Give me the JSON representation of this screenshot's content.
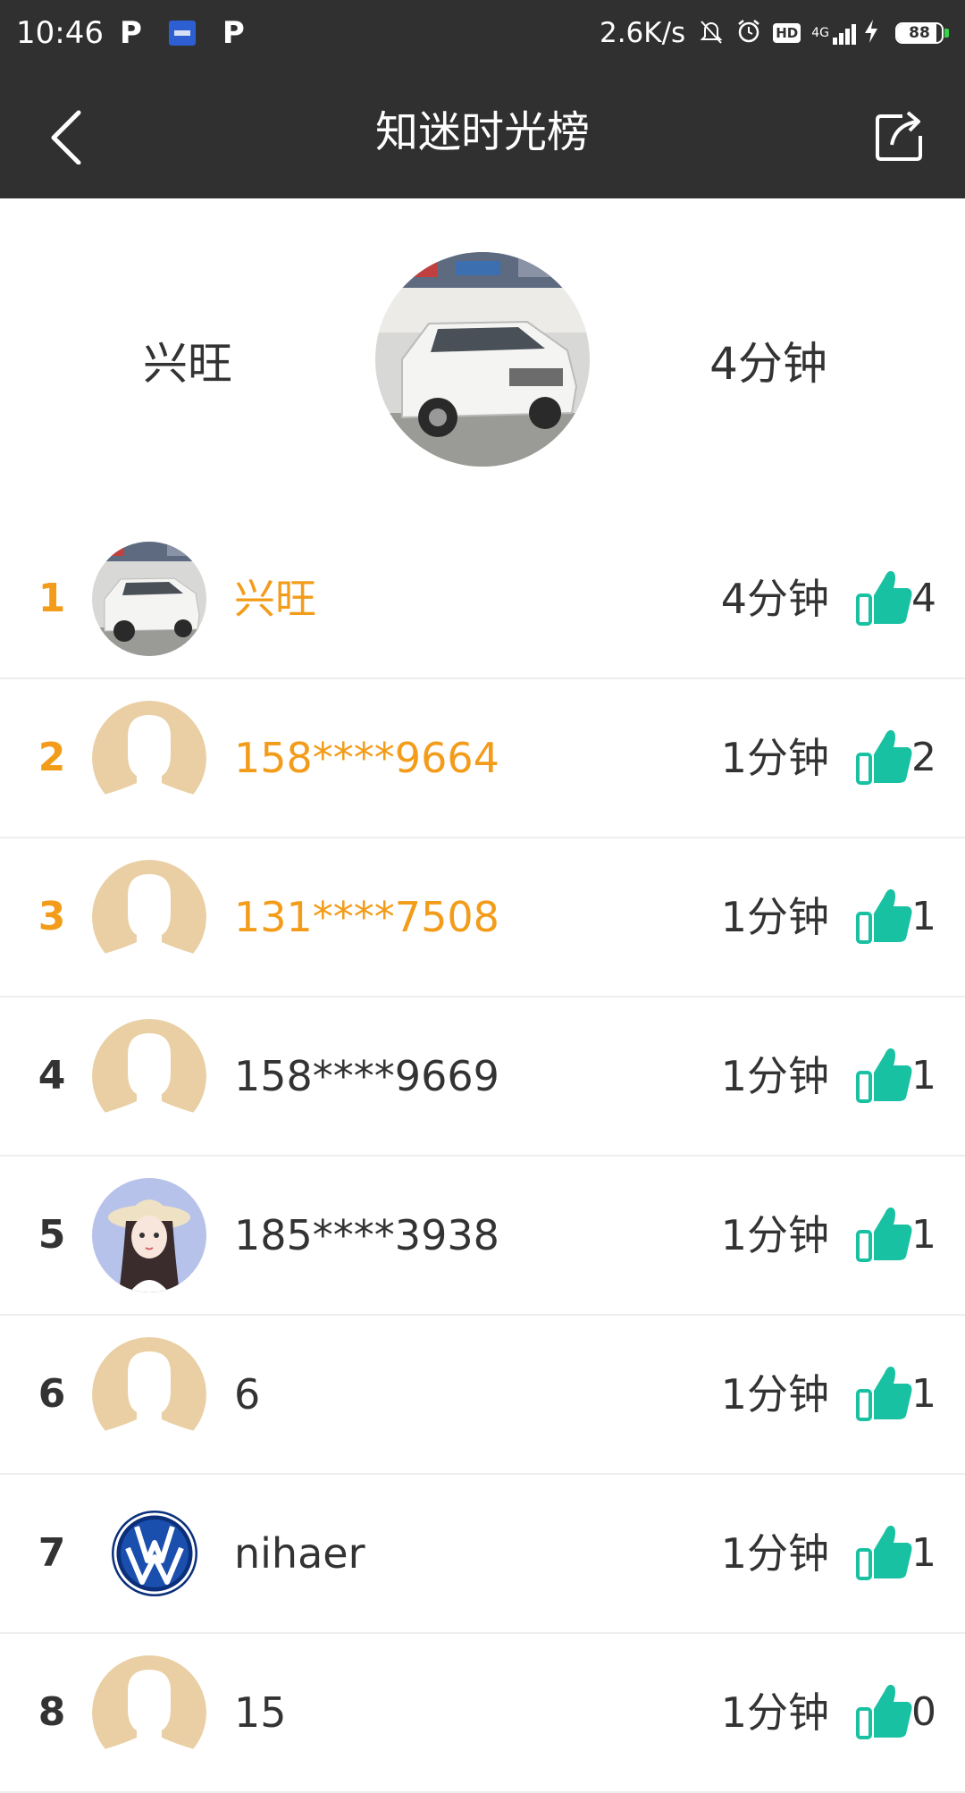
{
  "status_bar": {
    "time": "10:46",
    "app_icon_p": "P",
    "speed": "2.6K/s",
    "hd": "HD",
    "network": "4G",
    "battery_level": "88",
    "battery_fraction": 0.88
  },
  "header": {
    "title": "知迷时光榜",
    "back_icon": "chevron-left-icon",
    "share_icon": "share-icon"
  },
  "top_user": {
    "name": "兴旺",
    "time": "4分钟",
    "avatar": "car-photo"
  },
  "leaderboard": [
    {
      "rank": "1",
      "name": "兴旺",
      "time": "4分钟",
      "likes": "4",
      "avatar": "car-photo",
      "highlight": true
    },
    {
      "rank": "2",
      "name": "158****9664",
      "time": "1分钟",
      "likes": "2",
      "avatar": "default-avatar",
      "highlight": true
    },
    {
      "rank": "3",
      "name": "131****7508",
      "time": "1分钟",
      "likes": "1",
      "avatar": "default-avatar",
      "highlight": true
    },
    {
      "rank": "4",
      "name": "158****9669",
      "time": "1分钟",
      "likes": "1",
      "avatar": "default-avatar",
      "highlight": false
    },
    {
      "rank": "5",
      "name": "185****3938",
      "time": "1分钟",
      "likes": "1",
      "avatar": "girl-illustration",
      "highlight": false
    },
    {
      "rank": "6",
      "name": "6",
      "time": "1分钟",
      "likes": "1",
      "avatar": "default-avatar",
      "highlight": false
    },
    {
      "rank": "7",
      "name": "nihaer",
      "time": "1分钟",
      "likes": "1",
      "avatar": "vw-logo",
      "highlight": false
    },
    {
      "rank": "8",
      "name": "15",
      "time": "1分钟",
      "likes": "0",
      "avatar": "default-avatar",
      "highlight": false
    }
  ],
  "colors": {
    "header_bg": "#303030",
    "highlight": "#f39c1a",
    "like": "#19c1a3",
    "avatar_placeholder": "#e9cfa3"
  }
}
